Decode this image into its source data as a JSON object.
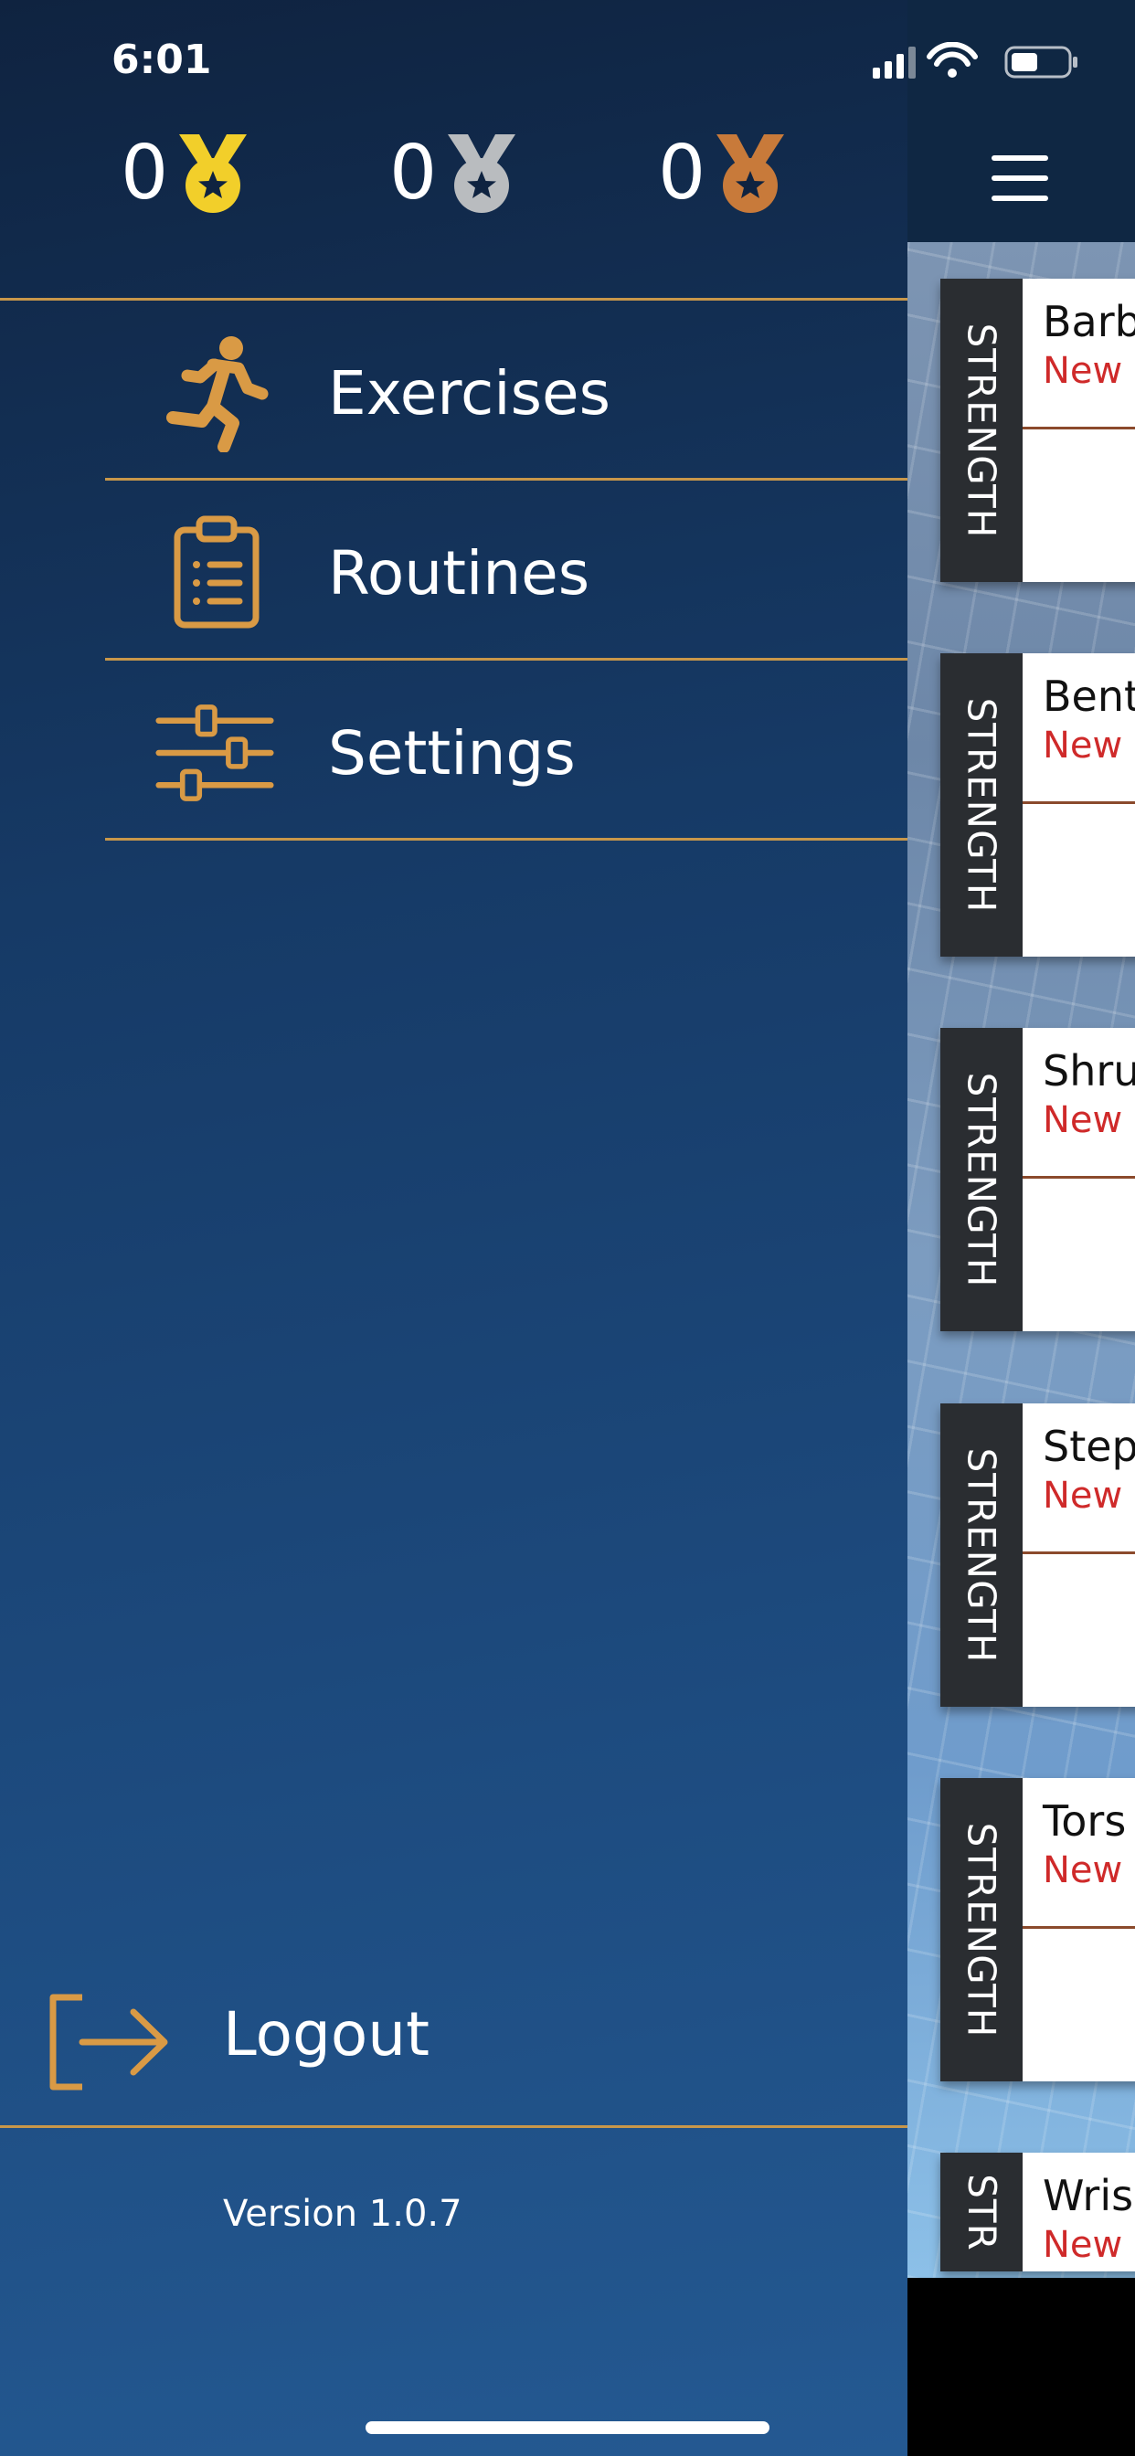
{
  "status_bar": {
    "time": "6:01"
  },
  "medals": [
    {
      "kind": "gold",
      "count": "0",
      "color": "#f2cf2a",
      "icon": "gold-medal-icon"
    },
    {
      "kind": "silver",
      "count": "0",
      "color": "#b9bcbf",
      "icon": "silver-medal-icon"
    },
    {
      "kind": "bronze",
      "count": "0",
      "color": "#c87a3a",
      "icon": "bronze-medal-icon"
    }
  ],
  "menu": {
    "items": [
      {
        "label": "Exercises",
        "icon": "running-person-icon"
      },
      {
        "label": "Routines",
        "icon": "clipboard-list-icon"
      },
      {
        "label": "Settings",
        "icon": "sliders-icon"
      }
    ],
    "logout_label": "Logout",
    "version": "Version 1.0.7"
  },
  "theme": {
    "accent": "#d99a45",
    "divider": "#c8974a"
  },
  "background_list": {
    "cards": [
      {
        "category": "STRENGTH",
        "title": "Barb",
        "status": "New"
      },
      {
        "category": "STRENGTH",
        "title": "Bent",
        "status": "New"
      },
      {
        "category": "STRENGTH",
        "title": "Shru",
        "status": "New"
      },
      {
        "category": "STRENGTH",
        "title": "Step",
        "status": "New"
      },
      {
        "category": "STRENGTH",
        "title": "Tors",
        "status": "New"
      },
      {
        "category": "STR",
        "title": "Wris",
        "status": "New"
      }
    ]
  }
}
